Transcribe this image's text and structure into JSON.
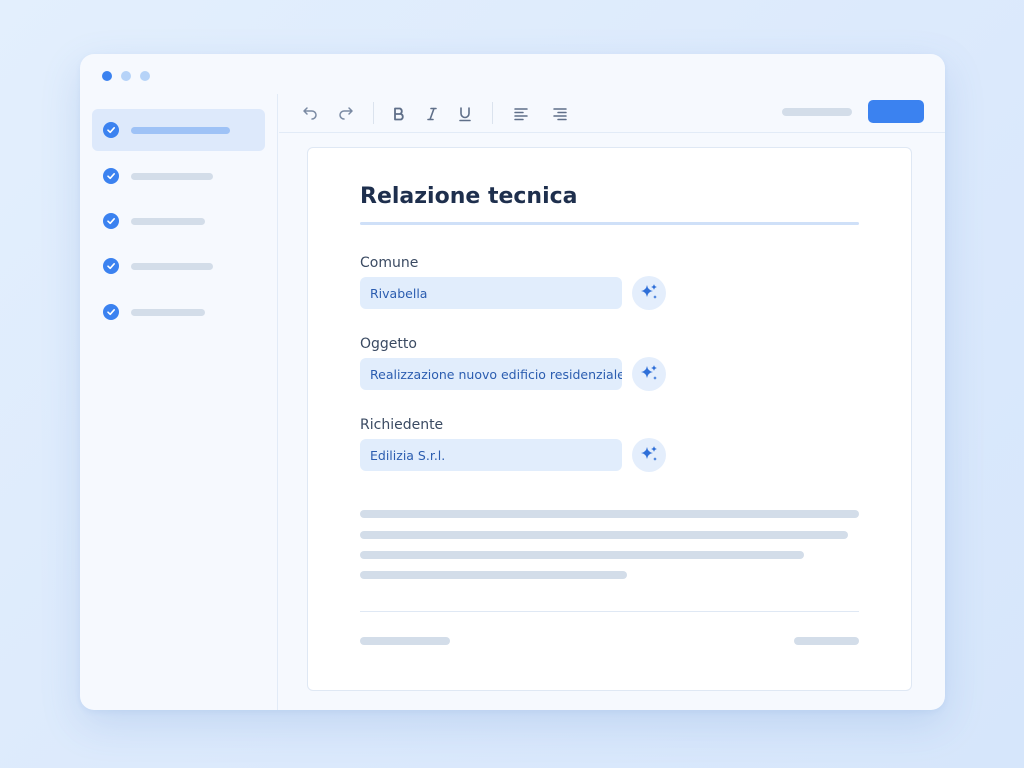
{
  "window": {
    "controls": [
      "close-dot",
      "minimize-dot",
      "maximize-dot"
    ]
  },
  "sidebar": {
    "items": [
      {
        "state": "completed",
        "active": true
      },
      {
        "state": "completed",
        "active": false
      },
      {
        "state": "completed",
        "active": false
      },
      {
        "state": "completed",
        "active": false
      },
      {
        "state": "completed",
        "active": false
      }
    ]
  },
  "toolbar": {
    "icons": [
      "undo-icon",
      "redo-icon",
      "bold-icon",
      "italic-icon",
      "underline-icon",
      "align-left-icon",
      "align-right-icon"
    ]
  },
  "document": {
    "title": "Relazione tecnica",
    "fields": [
      {
        "label": "Comune",
        "value": "Rivabella",
        "action_icon": "sparkle-icon"
      },
      {
        "label": "Oggetto",
        "value": "Realizzazione nuovo edificio residenziale",
        "action_icon": "sparkle-icon"
      },
      {
        "label": "Richiedente",
        "value": "Edilizia S.r.l.",
        "action_icon": "sparkle-icon"
      }
    ]
  },
  "colors": {
    "accent": "#3b82f0",
    "field_bg": "#e1edfc",
    "field_text": "#2b5db0",
    "title_text": "#1e2f4d",
    "placeholder_line": "#d3dde9"
  }
}
